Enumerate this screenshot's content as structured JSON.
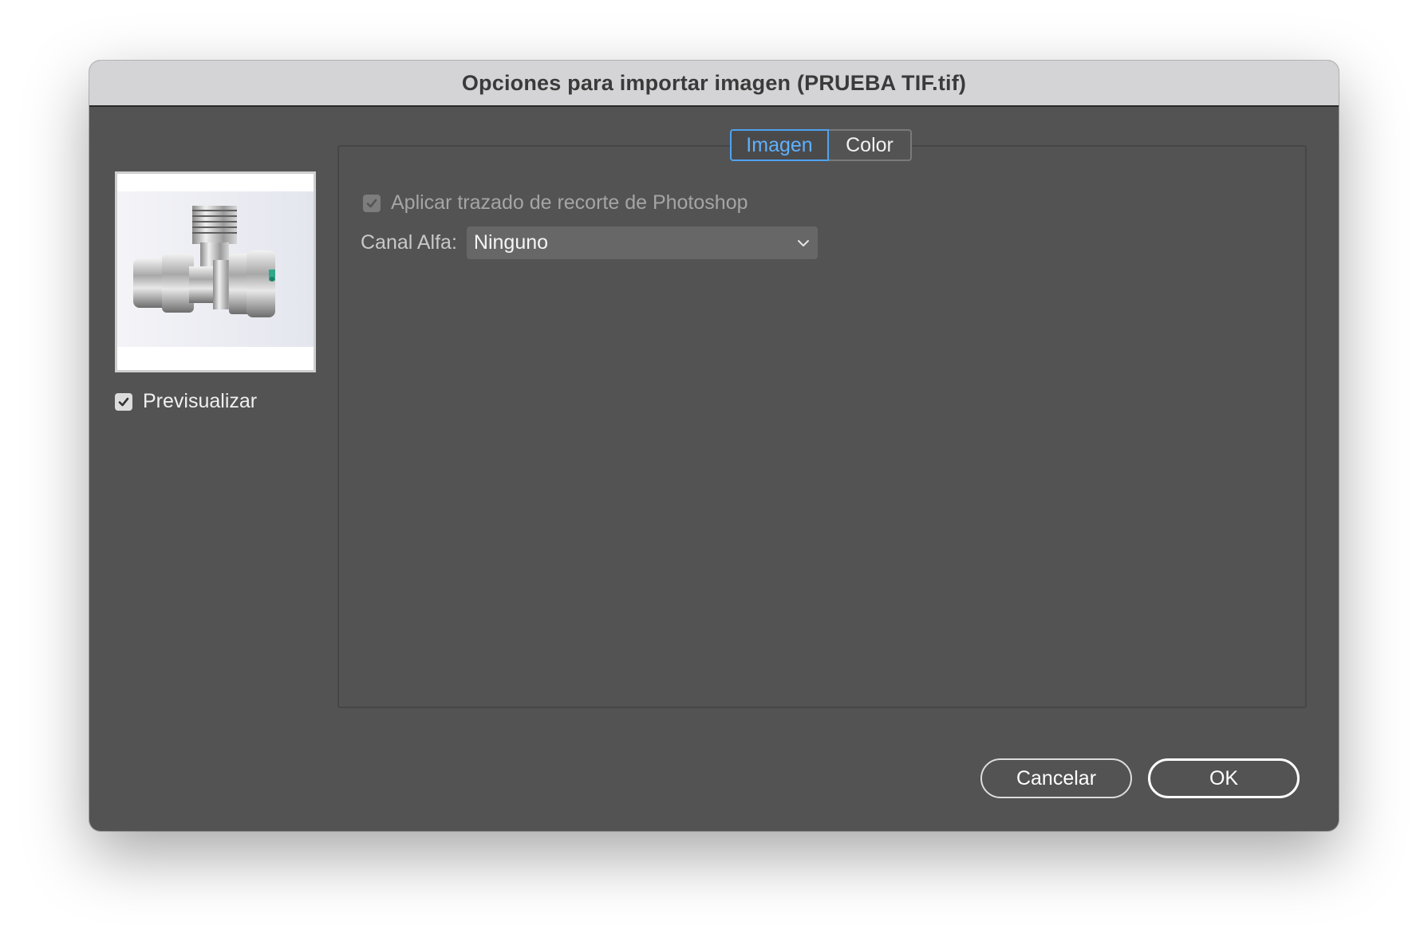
{
  "dialog": {
    "title": "Opciones para importar imagen (PRUEBA TIF.tif)"
  },
  "preview": {
    "checkbox_label": "Previsualizar",
    "checked": true
  },
  "tabs": [
    {
      "label": "Imagen",
      "active": true
    },
    {
      "label": "Color",
      "active": false
    }
  ],
  "image_tab": {
    "clipping_path_label": "Aplicar trazado de recorte de Photoshop",
    "clipping_path_checked": true,
    "clipping_path_enabled": false,
    "alpha_channel_label": "Canal Alfa:",
    "alpha_channel_value": "Ninguno"
  },
  "buttons": {
    "cancel": "Cancelar",
    "ok": "OK"
  },
  "colors": {
    "window_bg": "#535353",
    "titlebar_bg": "#d4d4d6",
    "accent": "#4ea3f0"
  }
}
